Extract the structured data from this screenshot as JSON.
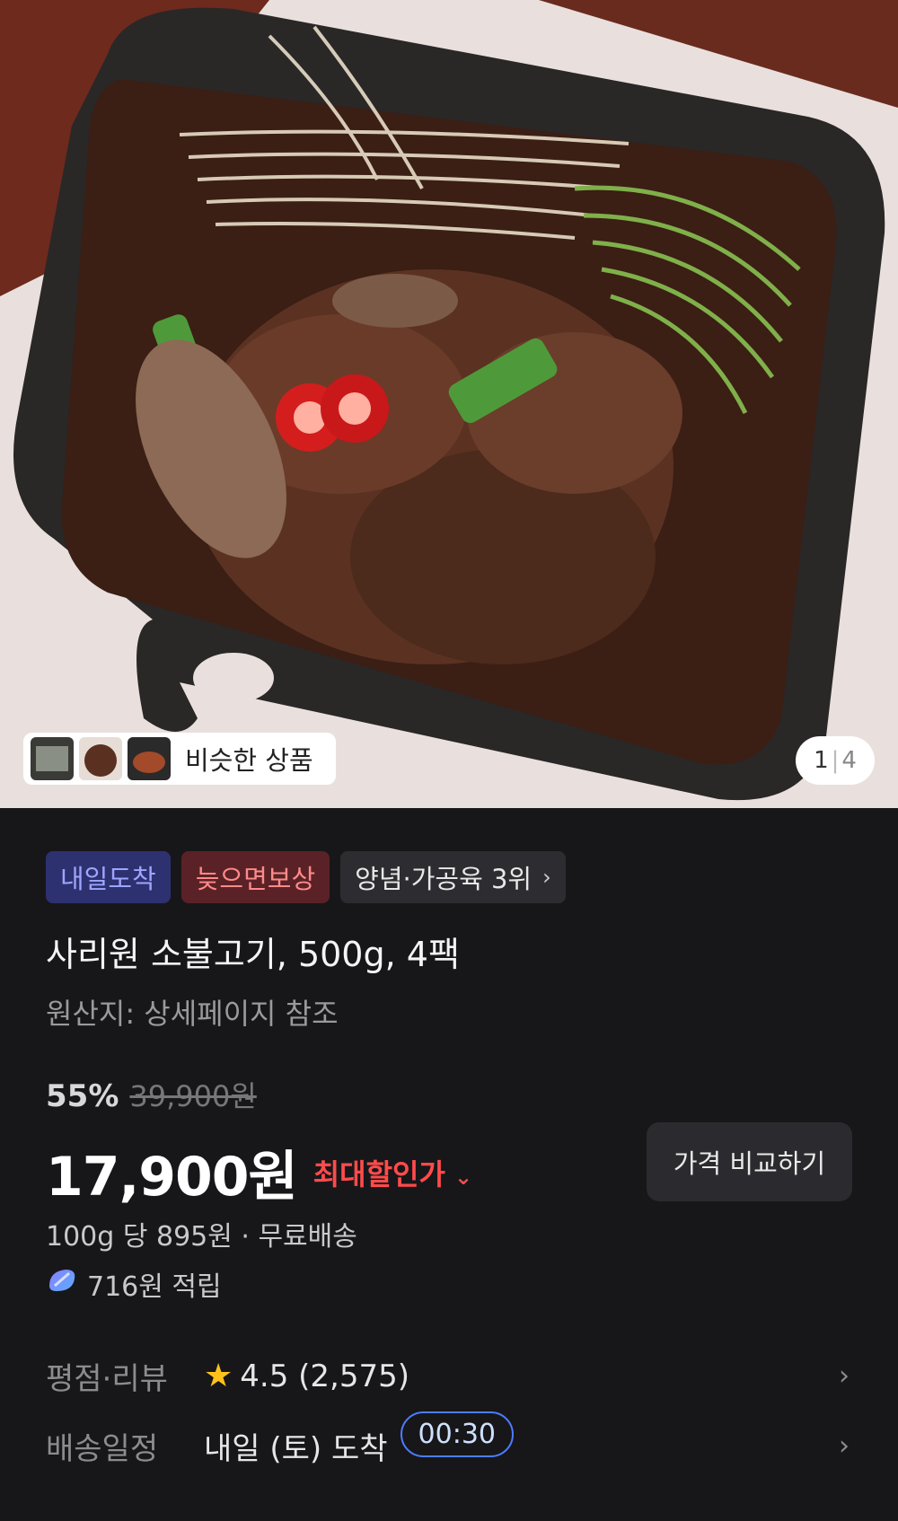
{
  "hero": {
    "similar_label": "비슷한 상품",
    "pager": {
      "current": "1",
      "separator": "|",
      "total": "4"
    }
  },
  "badges": [
    {
      "label": "내일도착"
    },
    {
      "label": "늦으면보상"
    },
    {
      "label": "양념·가공육 3위",
      "chevron": "›"
    }
  ],
  "product": {
    "title": "사리원 소불고기, 500g, 4팩",
    "origin": "원산지: 상세페이지 참조"
  },
  "pricing": {
    "discount_rate": "55%",
    "original_price": "39,900원",
    "sale_price": "17,900원",
    "max_discount_label": "최대할인가",
    "max_discount_chevron": "⌄",
    "compare_button": "가격 비교하기",
    "unit_price_line": "100g 당 895원 · 무료배송",
    "points": "716원 적립"
  },
  "info": {
    "rating_label": "평점·리뷰",
    "rating_value": "4.5 (2,575)",
    "delivery_label": "배송일정",
    "delivery_value": "내일 (토) 도착",
    "timer": "00:30",
    "chevron": "›"
  },
  "colors": {
    "background": "#17171a",
    "accent_red": "#ff4b4b",
    "badge_blue_bg": "#2e3170",
    "badge_red_bg": "#5a2226",
    "star": "#ffc21a",
    "timer_border": "#4d7cff"
  }
}
